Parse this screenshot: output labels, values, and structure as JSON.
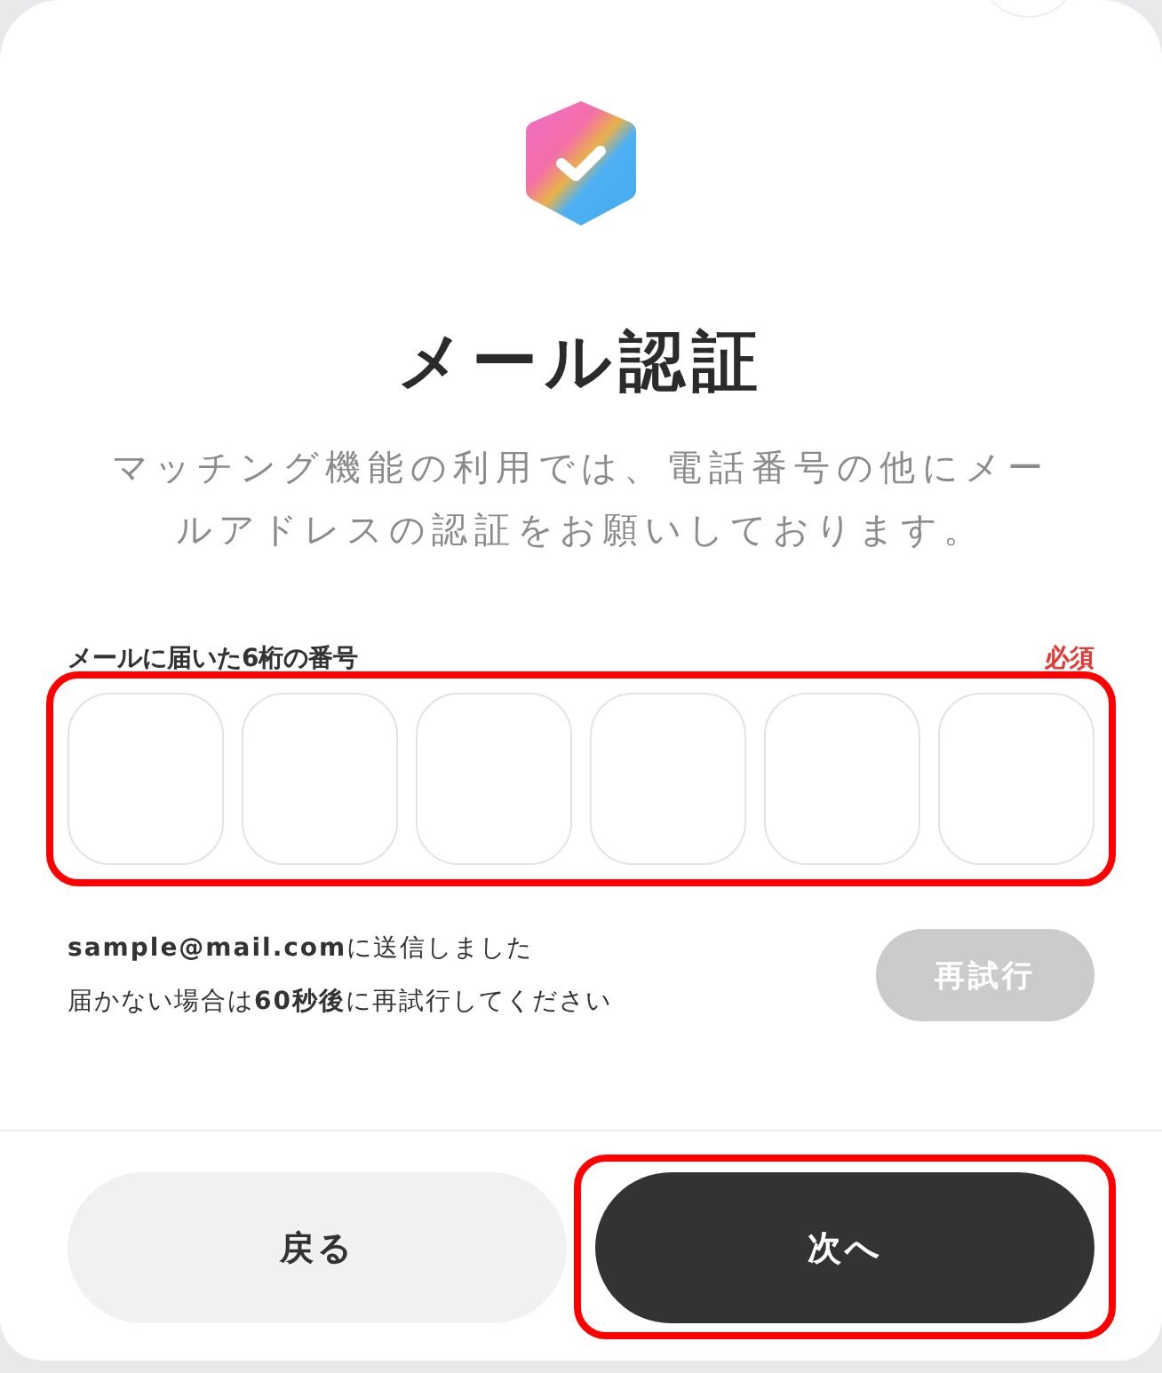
{
  "title": "メール認証",
  "description": "マッチング機能の利用では、電話番号の他にメールアドレスの認証をお願いしております。",
  "code_field": {
    "label": "メールに届いた6桁の番号",
    "required_badge": "必須",
    "highlighted": true,
    "digits": [
      {
        "focused": false
      },
      {
        "focused": false
      },
      {
        "focused": false
      },
      {
        "focused": false
      },
      {
        "focused": false
      },
      {
        "focused": false
      }
    ]
  },
  "sent_message": "**sample@mail.com**に送信しました",
  "retry_hint": "届かない場合は**60秒後**に再試行してください",
  "retry_button": {
    "label": "再試行",
    "disabled": true
  },
  "buttons": [
    {
      "label": "戻る",
      "kind": "secondary",
      "highlighted": false
    },
    {
      "label": "次へ",
      "kind": "primary",
      "highlighted": true
    }
  ]
}
